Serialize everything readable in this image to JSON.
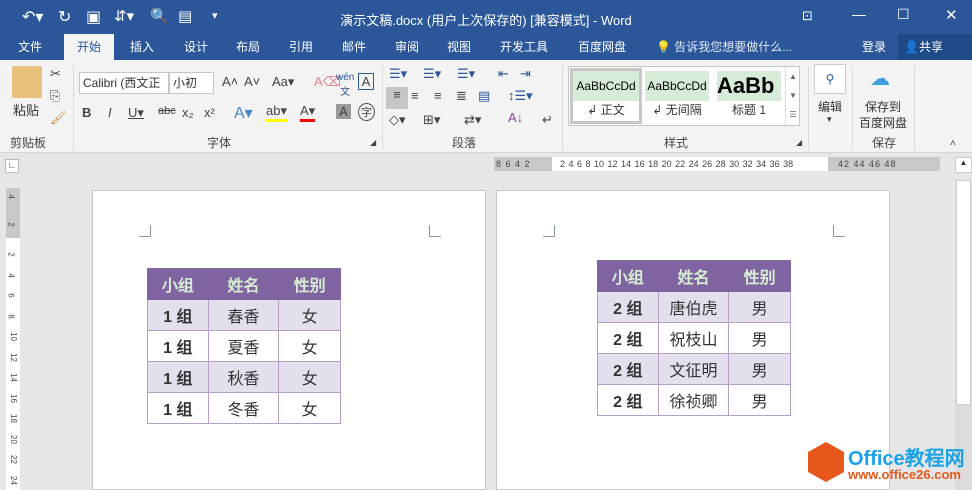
{
  "titlebar": {
    "title": "演示文稿.docx (用户上次保存的) [兼容模式] - Word"
  },
  "tabs": [
    "文件",
    "开始",
    "插入",
    "设计",
    "布局",
    "引用",
    "邮件",
    "审阅",
    "视图",
    "开发工具",
    "百度网盘"
  ],
  "tell_me": "告诉我您想要做什么...",
  "login": "登录",
  "share": "共享",
  "ribbon": {
    "paste": "粘贴",
    "clipboard": "剪贴板",
    "font_name": "Calibri (西文正",
    "font_size": "小初",
    "font_group": "字体",
    "paragraph_group": "段落",
    "styles_group": "样式",
    "styles": [
      {
        "preview": "AaBbCcDd",
        "name": "正文"
      },
      {
        "preview": "AaBbCcDd",
        "name": "无间隔"
      },
      {
        "preview": "AaBb",
        "name": "标题 1"
      }
    ],
    "edit": "编辑",
    "save_baidu_1": "保存到",
    "save_baidu_2": "百度网盘",
    "save_group": "保存"
  },
  "ruler": {
    "left": "8 6 4 2",
    "main": "2 4 6 8 10 12 14 16 18 20 22 24 26 28 30 32 34 36 38",
    "right": "42 44 46 48"
  },
  "vruler": [
    "4",
    "2",
    "2",
    "4",
    "6",
    "8",
    "10",
    "12",
    "14",
    "16",
    "18",
    "20",
    "22",
    "24"
  ],
  "table1": {
    "headers": [
      "小组",
      "姓名",
      "性别"
    ],
    "rows": [
      [
        "1 组",
        "春香",
        "女"
      ],
      [
        "1 组",
        "夏香",
        "女"
      ],
      [
        "1 组",
        "秋香",
        "女"
      ],
      [
        "1 组",
        "冬香",
        "女"
      ]
    ]
  },
  "table2": {
    "headers": [
      "小组",
      "姓名",
      "性别"
    ],
    "rows": [
      [
        "2 组",
        "唐伯虎",
        "男"
      ],
      [
        "2 组",
        "祝枝山",
        "男"
      ],
      [
        "2 组",
        "文征明",
        "男"
      ],
      [
        "2 组",
        "徐祯卿",
        "男"
      ]
    ]
  },
  "watermark": {
    "brand": "Office教程网",
    "url": "www.office26.com"
  }
}
